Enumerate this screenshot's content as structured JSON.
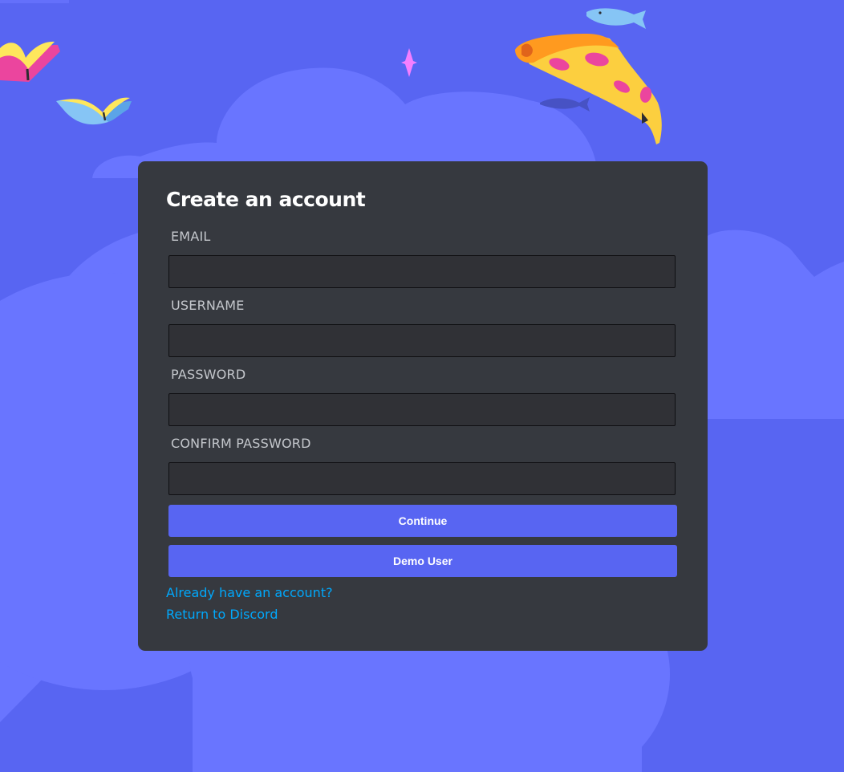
{
  "colors": {
    "background": "#5865f2",
    "cloud": "#6975ff",
    "card": "#36393f",
    "input": "#303136",
    "button": "#5865f2",
    "link": "#00a8fc"
  },
  "decorations": [
    "book-illustration",
    "fish-illustration",
    "pizza-illustration",
    "sparkle-illustration",
    "cloud-illustration"
  ],
  "form": {
    "title": "Create an account",
    "fields": [
      {
        "label": "EMAIL",
        "value": ""
      },
      {
        "label": "USERNAME",
        "value": ""
      },
      {
        "label": "PASSWORD",
        "value": ""
      },
      {
        "label": "CONFIRM PASSWORD",
        "value": ""
      }
    ],
    "buttons": {
      "continue": "Continue",
      "demo": "Demo User"
    },
    "links": {
      "login": "Already have an account?",
      "return": "Return to Discord"
    }
  }
}
